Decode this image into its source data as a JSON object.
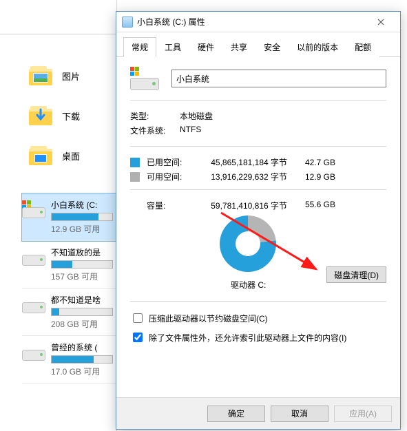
{
  "explorer": {
    "libs": [
      {
        "label": "图片",
        "kind": "pictures"
      },
      {
        "label": "下载",
        "kind": "downloads"
      },
      {
        "label": "桌面",
        "kind": "desktop"
      }
    ],
    "drives": [
      {
        "name": "小白系统 (C:",
        "free": "12.9 GB 可用",
        "pct": 77,
        "win": true,
        "sel": true
      },
      {
        "name": "不知道放的是",
        "free": "157 GB 可用",
        "pct": 34,
        "win": false,
        "sel": false
      },
      {
        "name": "都不知道是啥",
        "free": "208 GB 可用",
        "pct": 12,
        "win": false,
        "sel": false
      },
      {
        "name": "曾经的系统 (",
        "free": "17.0 GB 可用",
        "pct": 69,
        "win": false,
        "sel": false
      }
    ]
  },
  "dialog": {
    "title": "小白系统 (C:) 属性",
    "tabs": [
      "常规",
      "工具",
      "硬件",
      "共享",
      "安全",
      "以前的版本",
      "配额"
    ],
    "active_tab": 0,
    "drive_name": "小白系统",
    "type_label": "类型:",
    "type_value": "本地磁盘",
    "fs_label": "文件系统:",
    "fs_value": "NTFS",
    "used_label": "已用空间:",
    "used_bytes": "45,865,181,184 字节",
    "used_gb": "42.7 GB",
    "free_label": "可用空间:",
    "free_bytes": "13,916,229,632 字节",
    "free_gb": "12.9 GB",
    "cap_label": "容量:",
    "cap_bytes": "59,781,410,816 字节",
    "cap_gb": "55.6 GB",
    "drive_label": "驱动器 C:",
    "cleanup_btn": "磁盘清理(D)",
    "chk_compress": "压缩此驱动器以节约磁盘空间(C)",
    "chk_index": "除了文件属性外，还允许索引此驱动器上文件的内容(I)",
    "ok": "确定",
    "cancel": "取消",
    "apply": "应用(A)"
  },
  "chart_data": {
    "type": "pie",
    "title": "驱动器 C:",
    "series": [
      {
        "name": "已用空间",
        "value_bytes": 45865181184,
        "value_gb": 42.7,
        "color": "#26a0da"
      },
      {
        "name": "可用空间",
        "value_bytes": 13916229632,
        "value_gb": 12.9,
        "color": "#b5b5b5"
      }
    ],
    "total_bytes": 59781410816,
    "total_gb": 55.6
  }
}
